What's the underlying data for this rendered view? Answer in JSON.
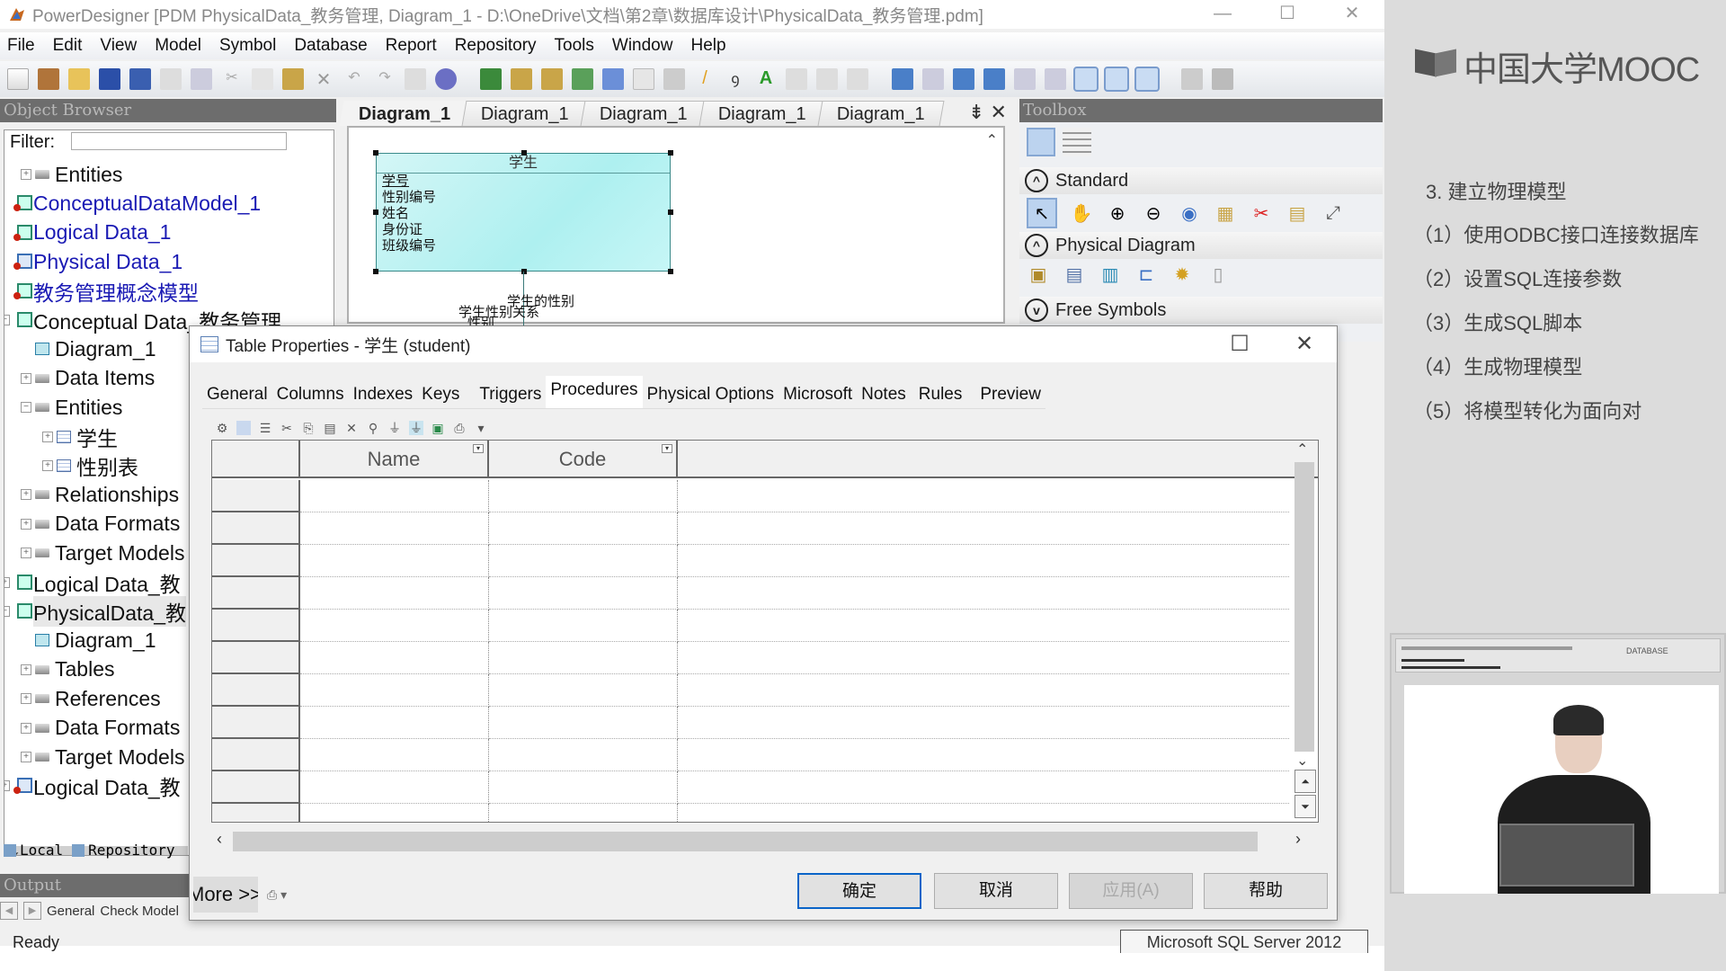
{
  "window": {
    "title": "PowerDesigner [PDM PhysicalData_教务管理, Diagram_1 - D:\\OneDrive\\文档\\第2章\\数据库设计\\PhysicalData_教务管理.pdm]",
    "minimize": "—",
    "maximize": "☐",
    "close": "✕"
  },
  "menu": [
    "File",
    "Edit",
    "View",
    "Model",
    "Symbol",
    "Database",
    "Report",
    "Repository",
    "Tools",
    "Window",
    "Help"
  ],
  "object_browser": {
    "title": "Object Browser",
    "filter_label": "Filter:",
    "filter_value": "",
    "tree": [
      {
        "label": "Entities",
        "type": "folder",
        "expander": "+",
        "level": 1
      },
      {
        "label": "ConceptualDataModel_1",
        "type": "model",
        "color": "blue",
        "level": 0
      },
      {
        "label": "Logical Data_1",
        "type": "model",
        "color": "blue",
        "level": 0
      },
      {
        "label": "Physical Data_1",
        "type": "model-pd",
        "color": "blue",
        "level": 0
      },
      {
        "label": "教务管理概念模型",
        "type": "model",
        "color": "blue",
        "level": 0
      },
      {
        "label": "Conceptual Data_教务管理",
        "type": "model-np",
        "expander": "−",
        "level": 0
      },
      {
        "label": "Diagram_1",
        "type": "diagram",
        "level": 1
      },
      {
        "label": "Data Items",
        "type": "folder",
        "expander": "+",
        "level": 1
      },
      {
        "label": "Entities",
        "type": "folder",
        "expander": "−",
        "level": 1
      },
      {
        "label": "学生",
        "type": "table",
        "expander": "+",
        "level": 2
      },
      {
        "label": "性别表",
        "type": "table",
        "expander": "+",
        "level": 2
      },
      {
        "label": "Relationships",
        "type": "folder",
        "expander": "+",
        "level": 1
      },
      {
        "label": "Data Formats",
        "type": "folder",
        "expander": "+",
        "level": 1
      },
      {
        "label": "Target Models",
        "type": "folder",
        "expander": "+",
        "level": 1
      },
      {
        "label": "Logical Data_教",
        "type": "model-np",
        "expander": "+",
        "level": 0
      },
      {
        "label": "PhysicalData_教",
        "type": "model-np",
        "expander": "−",
        "level": 0,
        "selected": true
      },
      {
        "label": "Diagram_1",
        "type": "diagram",
        "level": 1
      },
      {
        "label": "Tables",
        "type": "folder",
        "expander": "+",
        "level": 1
      },
      {
        "label": "References",
        "type": "folder",
        "expander": "+",
        "level": 1
      },
      {
        "label": "Data Formats",
        "type": "folder",
        "expander": "+",
        "level": 1
      },
      {
        "label": "Target Models",
        "type": "folder",
        "expander": "+",
        "level": 1
      },
      {
        "label": "Logical Data_教",
        "type": "model-pd",
        "expander": "+",
        "level": 0
      }
    ],
    "tabs": [
      "Local",
      "Repository"
    ]
  },
  "output": {
    "title": "Output",
    "tabs": [
      "General",
      "Check Model"
    ]
  },
  "status": {
    "text": "Ready",
    "dbms": "Microsoft SQL Server 2012"
  },
  "diagram": {
    "tabs": [
      "Diagram_1",
      "Diagram_1",
      "Diagram_1",
      "Diagram_1",
      "Diagram_1"
    ],
    "active_tab": 0,
    "entity": {
      "name": "学生",
      "attributes": [
        "学号",
        "性别编号",
        "姓名",
        "身份证",
        "班级编号"
      ]
    },
    "relation_labels": [
      "学生的性别",
      "学生性别关系",
      "性别"
    ]
  },
  "toolbox": {
    "title": "Toolbox",
    "sections": [
      {
        "label": "Standard",
        "expanded": true
      },
      {
        "label": "Physical Diagram",
        "expanded": true
      },
      {
        "label": "Free Symbols",
        "expanded": false
      }
    ]
  },
  "dialog": {
    "title": "Table Properties - 学生 (student)",
    "tabs": [
      "General",
      "Columns",
      "Indexes",
      "Keys",
      "Triggers",
      "Procedures",
      "Physical Options",
      "Microsoft",
      "Notes",
      "Rules",
      "Preview"
    ],
    "active_tab": "Procedures",
    "grid": {
      "columns": [
        "Name",
        "Code"
      ],
      "rows": []
    },
    "more_label": "More >>",
    "buttons": {
      "ok": "确定",
      "cancel": "取消",
      "apply": "应用(A)",
      "help": "帮助"
    }
  },
  "mooc": {
    "logo": "中国大学MOOC",
    "outline_title": "3. 建立物理模型",
    "outline_items": [
      "（1）使用ODBC接口连接数据库",
      "（2）设置SQL连接参数",
      "（3）生成SQL脚本",
      "（4）生成物理模型",
      "（5）将模型转化为面向对"
    ],
    "video_hud_label": "DATABASE"
  }
}
